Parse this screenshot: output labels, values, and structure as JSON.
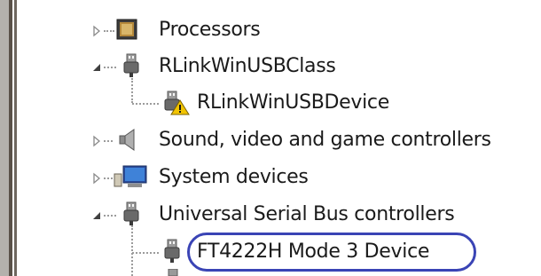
{
  "tree": {
    "items": [
      {
        "label": "Processors",
        "expanded": false,
        "icon": "processor-icon"
      },
      {
        "label": "RLinkWinUSBClass",
        "expanded": true,
        "icon": "usb-plug-icon"
      },
      {
        "label": "RLinkWinUSBDevice",
        "icon": "usb-plug-warning-icon",
        "status": "warning"
      },
      {
        "label": "Sound, video and game controllers",
        "expanded": false,
        "icon": "speaker-icon"
      },
      {
        "label": "System devices",
        "expanded": false,
        "icon": "computer-icon"
      },
      {
        "label": "Universal Serial Bus controllers",
        "expanded": true,
        "icon": "usb-plug-icon"
      },
      {
        "label": "FT4222H Mode 3 Device",
        "icon": "usb-plug-icon",
        "highlighted": true
      }
    ]
  },
  "colors": {
    "highlight": "#3a44b5",
    "warning": "#f2c400",
    "frame": "#5a5148"
  }
}
